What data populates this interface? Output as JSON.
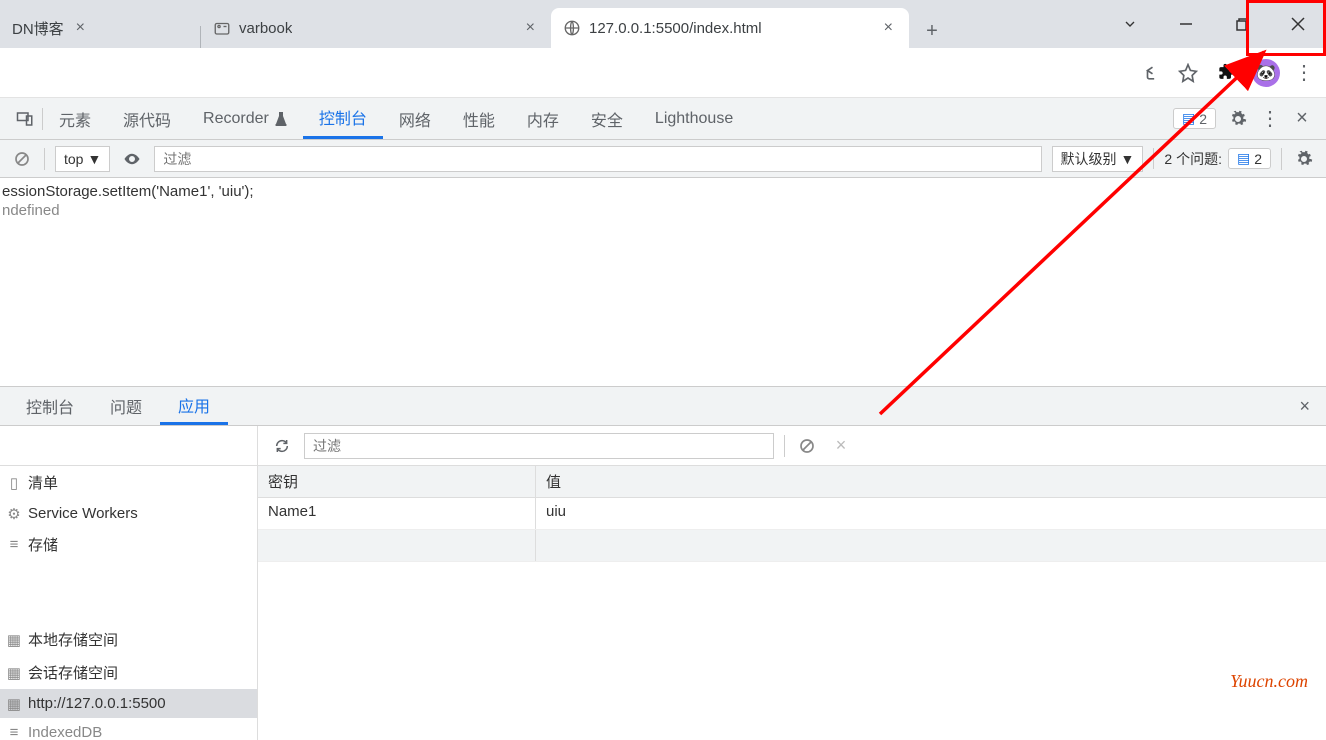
{
  "chrome": {
    "tabs": [
      {
        "title": "DN博客"
      },
      {
        "title": "varbook"
      },
      {
        "title": "127.0.0.1:5500/index.html"
      }
    ],
    "toolbar": {}
  },
  "devtools": {
    "tabs": {
      "elements": "元素",
      "sources": "源代码",
      "recorder": "Recorder",
      "console": "控制台",
      "network": "网络",
      "performance": "性能",
      "memory": "内存",
      "security": "安全",
      "lighthouse": "Lighthouse"
    },
    "badge_count": "2",
    "console_toolbar": {
      "context": "top",
      "filter_placeholder": "过滤",
      "level": "默认级别",
      "issues_label": "2 个问题:",
      "issues_count": "2"
    },
    "console_output": {
      "line1": "essionStorage.setItem('Name1', 'uiu');",
      "line2": "ndefined"
    }
  },
  "drawer": {
    "tabs": {
      "console": "控制台",
      "issues": "问题",
      "application": "应用"
    }
  },
  "app": {
    "sidebar": {
      "manifest": "清单",
      "service_workers": "Service Workers",
      "storage": "存储",
      "local_storage": "本地存储空间",
      "session_storage": "会话存储空间",
      "origin": "http://127.0.0.1:5500",
      "indexeddb": "IndexedDB"
    },
    "filter_placeholder": "过滤",
    "table": {
      "key_header": "密钥",
      "value_header": "值",
      "rows": [
        {
          "key": "Name1",
          "value": "uiu"
        }
      ]
    }
  },
  "watermark": "Yuucn.com"
}
